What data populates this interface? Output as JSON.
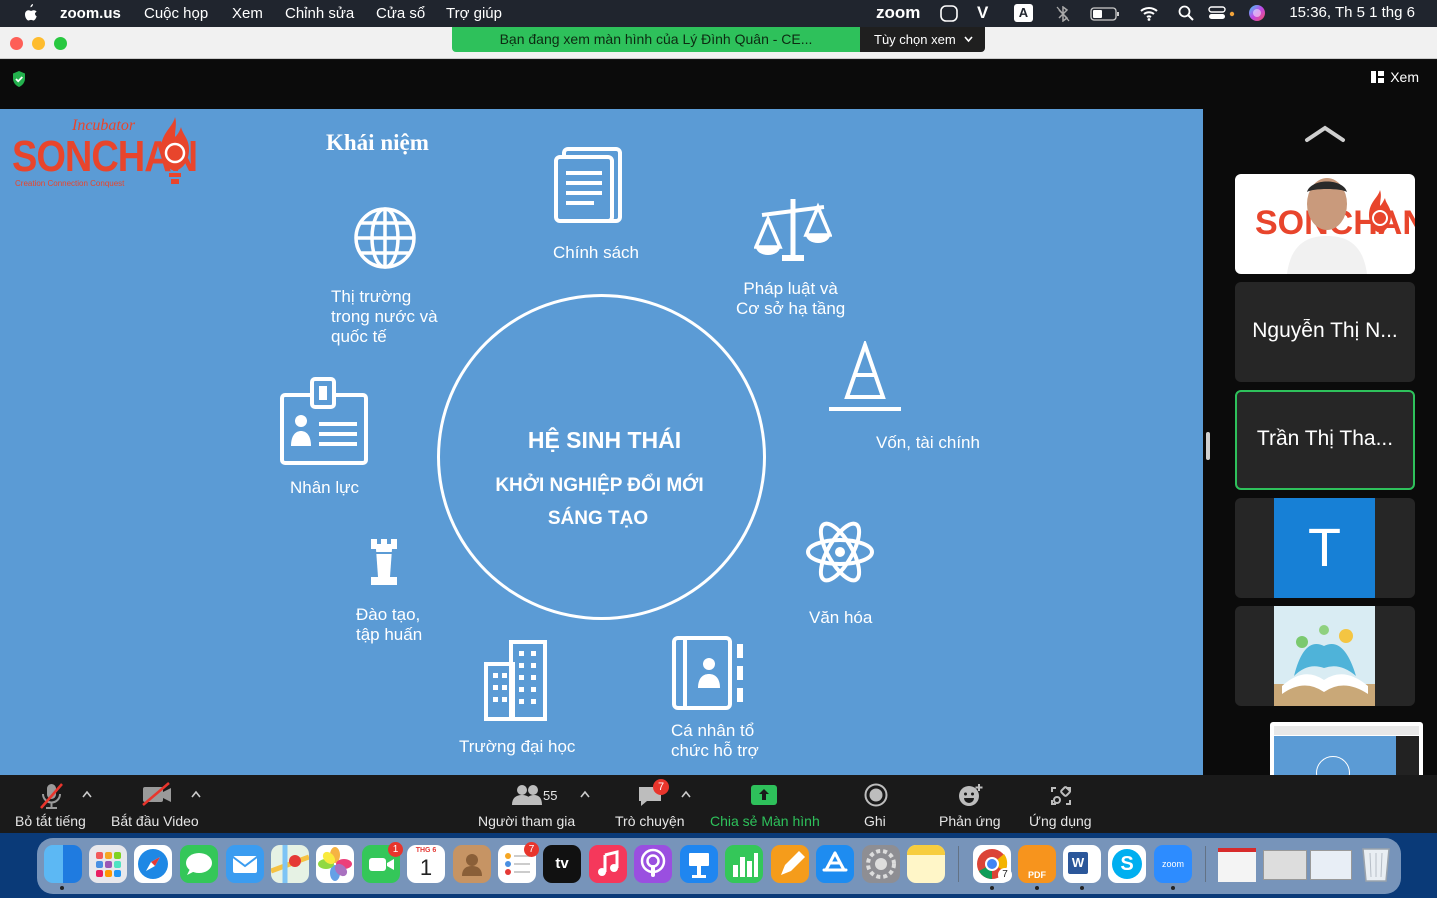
{
  "menubar": {
    "app_name": "zoom.us",
    "items": [
      "Cuộc họp",
      "Xem",
      "Chỉnh sửa",
      "Cửa sổ",
      "Trợ giúp"
    ],
    "zoom_logo": "zoom",
    "v_label": "V",
    "a_label": "A",
    "clock": "15:36, Th 5 1 thg 6"
  },
  "titlebar": {
    "share_banner": "Bạn đang xem màn hình của Lý Đình Quân - CE...",
    "view_options": "Tùy chọn xem",
    "view_button": "Xem"
  },
  "slide": {
    "title": "Khái niệm",
    "logo_top": "Incubator",
    "logo_main": "SONCHAN",
    "logo_tag": "Creation Connection Conquest",
    "center_line1": "HỆ SINH THÁI",
    "center_line2": "KHỞI NGHIỆP ĐỔI MỚI",
    "center_line3": "SÁNG TẠO",
    "nodes": [
      {
        "label": "Chính sách",
        "icon": "document-icon"
      },
      {
        "label": "Pháp luật và\nCơ sở hạ tầng",
        "icon": "scales-icon"
      },
      {
        "label": "Vốn, tài chính",
        "icon": "cone-icon"
      },
      {
        "label": "Văn hóa",
        "icon": "atom-icon"
      },
      {
        "label": "Cá nhân tổ\nchức hỗ trợ",
        "icon": "contact-book-icon"
      },
      {
        "label": "Trường đại học",
        "icon": "building-icon"
      },
      {
        "label": "Đào tạo,\ntập huấn",
        "icon": "chess-rook-icon"
      },
      {
        "label": "Nhân lực",
        "icon": "id-badge-icon"
      },
      {
        "label": "Thị trường\ntrong nước và\nquốc tế",
        "icon": "globe-icon"
      }
    ]
  },
  "gallery": {
    "tiles": [
      {
        "type": "video",
        "icon": "participant-video"
      },
      {
        "type": "name",
        "name": "Nguyễn Thị N..."
      },
      {
        "type": "name",
        "name": "Trần Thị Tha...",
        "active": true
      },
      {
        "type": "avatar",
        "letter": "T"
      },
      {
        "type": "image",
        "icon": "book-picture"
      }
    ]
  },
  "toolbar": {
    "mute": "Bỏ tắt tiếng",
    "video": "Bắt đầu Video",
    "participants": "Người tham gia",
    "participants_count": "55",
    "chat": "Trò chuyện",
    "chat_badge": "7",
    "share": "Chia sẻ Màn hình",
    "record": "Ghi",
    "reactions": "Phản ứng",
    "apps": "Ứng dụng"
  },
  "dock": {
    "calendar_month": "THG 6",
    "calendar_day": "1",
    "facetime_badge": "1",
    "reminders_badge": "7",
    "chrome_badge": "7",
    "appletv_label": "tv",
    "pdf_label": "PDF",
    "word_label": "W",
    "skype_label": "S",
    "zoom_label": "zoom"
  },
  "colors": {
    "slide_bg": "#5b9bd5",
    "share_green": "#2ec15b",
    "active_border": "#2ec15b",
    "logo_red": "#e8452c"
  }
}
